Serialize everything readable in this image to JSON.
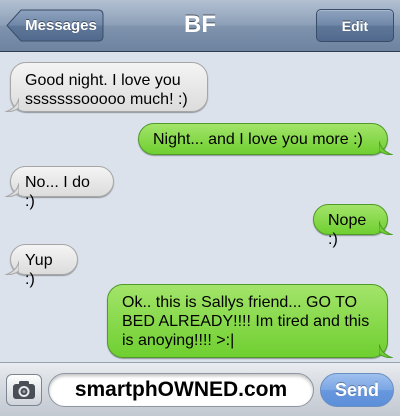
{
  "nav": {
    "back_label": "Messages",
    "title": "BF",
    "edit_label": "Edit"
  },
  "messages": [
    {
      "sender": "them",
      "text": "Good night. I love you sssssssooooo much! :)"
    },
    {
      "sender": "me",
      "text": "Night... and I love you more :)"
    },
    {
      "sender": "them",
      "text": "No... I do :)"
    },
    {
      "sender": "me",
      "text": "Nope :)"
    },
    {
      "sender": "them",
      "text": "Yup :)"
    },
    {
      "sender": "me",
      "text": "Ok.. this is Sallys friend... GO TO BED ALREADY!!!! Im tired and this is anoying!!!! >:|"
    }
  ],
  "input": {
    "value": "smartphOWNED.com",
    "camera_icon": "camera-icon"
  },
  "send_label": "Send",
  "colors": {
    "incoming_bubble": "#e8e8e8",
    "outgoing_bubble": "#8ad84e",
    "background": "#dbe2ec",
    "send_button": "#6898de"
  }
}
